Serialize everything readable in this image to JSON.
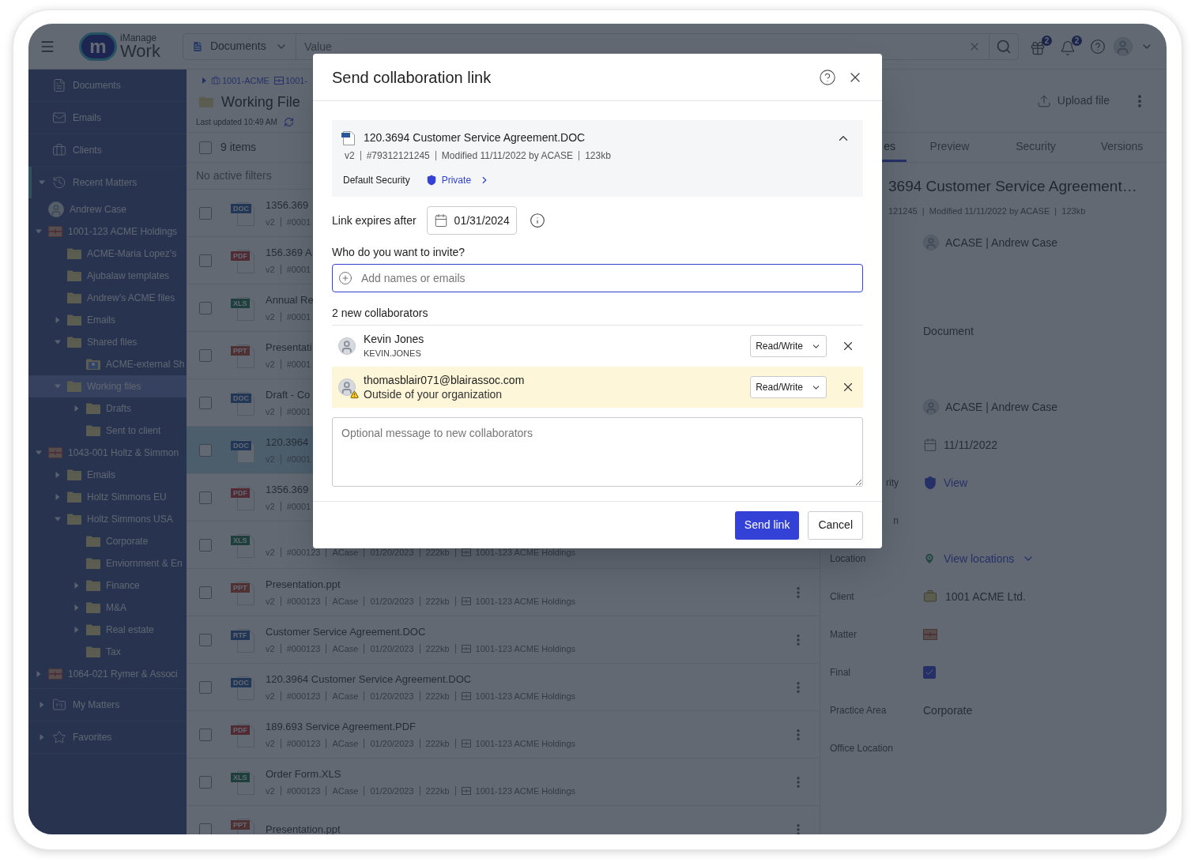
{
  "topbar": {
    "logo": {
      "mark": "m",
      "line1": "iManage",
      "line2": "Work"
    },
    "scope": "Documents",
    "search": {
      "placeholder": "Value"
    },
    "notifications": [
      {
        "count": "2"
      },
      {
        "count": "2"
      }
    ]
  },
  "sidebar": {
    "items": [
      {
        "kind": "document",
        "label": "Documents",
        "selected": false
      },
      {
        "kind": "email",
        "label": "Emails",
        "selected": false
      },
      {
        "kind": "clients",
        "label": "Clients",
        "selected": false
      },
      {
        "kind": "recent",
        "label": "Recent Matters",
        "selected": true,
        "expanded": true,
        "children": [
          {
            "kind": "person",
            "label": "Andrew Case",
            "selected": false
          },
          {
            "kind": "matter",
            "label": "1001-123 ACME Holdings",
            "expanded": true,
            "selected": false,
            "children": [
              {
                "kind": "folder",
                "label": "ACME-Maria Lopez’s",
                "selected": false
              },
              {
                "kind": "folder",
                "label": "Ajubalaw templates",
                "selected": false
              },
              {
                "kind": "folder",
                "label": "Andrew’s ACME files",
                "selected": false
              },
              {
                "kind": "folder",
                "label": "Emails",
                "expanded": false,
                "selected": false
              },
              {
                "kind": "folder",
                "label": "Shared files",
                "expanded": true,
                "selected": false,
                "children": [
                  {
                    "kind": "shared",
                    "label": "ACME-external Sh",
                    "selected": false
                  }
                ]
              },
              {
                "kind": "folder",
                "label": "Working files",
                "expanded": true,
                "selected": true,
                "children": [
                  {
                    "kind": "folder",
                    "label": "Drafts",
                    "expanded": false,
                    "selected": false
                  },
                  {
                    "kind": "folder",
                    "label": "Sent to client",
                    "selected": false
                  }
                ]
              }
            ]
          },
          {
            "kind": "matter",
            "label": "1043-001 Holtz & Simmon",
            "expanded": true,
            "selected": false,
            "children": [
              {
                "kind": "folder",
                "label": "Emails",
                "expanded": false,
                "selected": false
              },
              {
                "kind": "folder",
                "label": "Holtz Simmons EU",
                "expanded": false,
                "selected": false
              },
              {
                "kind": "folder",
                "label": "Holtz Simmons USA",
                "expanded": true,
                "selected": false,
                "children": [
                  {
                    "kind": "folder",
                    "label": "Corporate",
                    "selected": false
                  },
                  {
                    "kind": "folder",
                    "label": "Enviornment & En",
                    "selected": false
                  },
                  {
                    "kind": "folder",
                    "label": "Finance",
                    "expanded": false,
                    "selected": false
                  },
                  {
                    "kind": "folder",
                    "label": "M&A",
                    "expanded": false,
                    "selected": false
                  },
                  {
                    "kind": "folder",
                    "label": "Real estate",
                    "expanded": false,
                    "selected": false
                  },
                  {
                    "kind": "folder",
                    "label": "Tax",
                    "selected": false
                  }
                ]
              }
            ]
          },
          {
            "kind": "matter",
            "label": "1064-021 Rymer & Associ",
            "expanded": false,
            "selected": false
          }
        ]
      },
      {
        "kind": "mymatters",
        "label": "My Matters",
        "expanded": false,
        "selected": false
      },
      {
        "kind": "favorites",
        "label": "Favorites",
        "expanded": false,
        "selected": false
      }
    ]
  },
  "header": {
    "breadcrumb": [
      {
        "kind": "client",
        "label": "1001-ACME"
      },
      {
        "kind": "matter",
        "label": "1001-"
      }
    ],
    "title": "Working File",
    "updated": "Last updated 10:49 AM",
    "upload": "Upload file"
  },
  "list": {
    "count": "9 items",
    "all_selected": false,
    "filters": "No active filters",
    "rows": [
      {
        "type": "DOC",
        "title": "1356.369",
        "selected": false,
        "meta": {
          "version": "v2",
          "number": "#0001"
        }
      },
      {
        "type": "PDF",
        "title": "156.369 A",
        "selected": false,
        "meta": {
          "version": "v2",
          "number": "#0001"
        }
      },
      {
        "type": "XLS",
        "title": "Annual Re",
        "selected": false,
        "meta": {
          "version": "v2",
          "number": "#0001"
        }
      },
      {
        "type": "PPT",
        "title": "Presentati",
        "selected": false,
        "meta": {
          "version": "v2",
          "number": "#0001"
        }
      },
      {
        "type": "DOC",
        "title": "Draft - Co",
        "selected": false,
        "meta": {
          "version": "v2",
          "number": "#0001"
        }
      },
      {
        "type": "DOC",
        "title": "120.3964",
        "selected": true,
        "meta": {
          "version": "v2",
          "number": "#0001"
        }
      },
      {
        "type": "PDF",
        "title": "1356.369",
        "selected": false,
        "meta": {
          "version": "v2",
          "number": "#0001"
        }
      },
      {
        "type": "XLS",
        "selected": false,
        "meta": {
          "version": "v2",
          "number": "#000123",
          "author": "ACase",
          "date": "01/20/2023",
          "size": "222kb",
          "matter": "1001-123 ACME Holdings"
        }
      },
      {
        "type": "PPT",
        "title": "Presentation.ppt",
        "selected": false,
        "meta": {
          "version": "v2",
          "number": "#000123",
          "author": "ACase",
          "date": "01/20/2023",
          "size": "222kb",
          "matter": "1001-123 ACME Holdings"
        }
      },
      {
        "type": "RTF",
        "title": "Customer Service Agreement.DOC",
        "selected": false,
        "meta": {
          "version": "v2",
          "number": "#000123",
          "author": "ACase",
          "date": "01/20/2023",
          "size": "222kb",
          "matter": "1001-123 ACME Holdings"
        }
      },
      {
        "type": "DOC",
        "title": "120.3964 Customer Service Agreement.DOC",
        "selected": false,
        "meta": {
          "version": "v2",
          "number": "#000123",
          "author": "ACase",
          "date": "01/20/2023",
          "size": "222kb",
          "matter": "1001-123 ACME Holdings"
        }
      },
      {
        "type": "PDF",
        "title": "189.693 Service Agreement.PDF",
        "selected": false,
        "meta": {
          "version": "v2",
          "number": "#000123",
          "author": "ACase",
          "date": "01/20/2023",
          "size": "222kb",
          "matter": "1001-123 ACME Holdings"
        }
      },
      {
        "type": "XLS",
        "title": "Order Form.XLS",
        "selected": false,
        "meta": {
          "version": "v2",
          "number": "#000123",
          "author": "ACase",
          "date": "01/20/2023",
          "size": "222kb",
          "matter": "1001-123 ACME Holdings"
        }
      },
      {
        "type": "PPT",
        "title": "Presentation.ppt",
        "selected": false
      }
    ]
  },
  "panel": {
    "tabs": [
      {
        "label": "es",
        "selected": true
      },
      {
        "label": "Preview",
        "selected": false
      },
      {
        "label": "Security",
        "selected": false
      },
      {
        "label": "Versions",
        "selected": false
      }
    ],
    "title": "3694 Customer Service Agreement…",
    "meta": "121245  |  Modified 11/11/2022 by ACASE  |  123kb",
    "rows": [
      {
        "kind": "person",
        "value": "ACASE | Andrew Case"
      },
      {
        "kind": "blank"
      },
      {
        "kind": "text",
        "value": "Document"
      },
      {
        "kind": "blank"
      },
      {
        "kind": "person",
        "value": "ACASE | Andrew Case"
      },
      {
        "kind": "date",
        "value": "11/11/2022"
      },
      {
        "kind": "security",
        "label_end": "rity",
        "value": "View"
      },
      {
        "kind": "blank",
        "label_end": "n"
      },
      {
        "kind": "location",
        "label": "Location",
        "value": "View locations"
      },
      {
        "kind": "client",
        "label": "Client",
        "value": "1001 ACME Ltd."
      },
      {
        "kind": "matter",
        "label": "Matter"
      },
      {
        "kind": "check",
        "label": "Final",
        "checked": true
      },
      {
        "kind": "text",
        "label": "Practice Area",
        "value": "Corporate"
      },
      {
        "kind": "text",
        "label": "Office Location"
      }
    ]
  },
  "dialog": {
    "title": "Send collaboration link",
    "document": {
      "name": "120.3694 Customer Service Agreement.DOC",
      "expanded": true,
      "meta": [
        "v2",
        "#79312121245",
        "Modified 11/11/2022 by ACASE",
        "123kb"
      ],
      "security_label": "Default Security",
      "security": "Private"
    },
    "expires": {
      "label": "Link expires after",
      "date": "01/31/2024"
    },
    "invite": {
      "label": "Who do you want to invite?",
      "placeholder": "Add names or emails",
      "focused": true
    },
    "collaborators_heading": "2 new collaborators",
    "collaborators": [
      {
        "name": "Kevin Jones",
        "detail": "KEVIN.JONES",
        "external": false,
        "access": "Read/Write"
      },
      {
        "name": "thomasblair071@blairassoc.com",
        "detail": "Outside of your organization",
        "external": true,
        "access": "Read/Write"
      }
    ],
    "message": {
      "placeholder": "Optional message to new collaborators"
    },
    "buttons": [
      {
        "kind": "primary",
        "label": "Send link"
      },
      {
        "kind": "secondary",
        "label": "Cancel"
      }
    ]
  }
}
